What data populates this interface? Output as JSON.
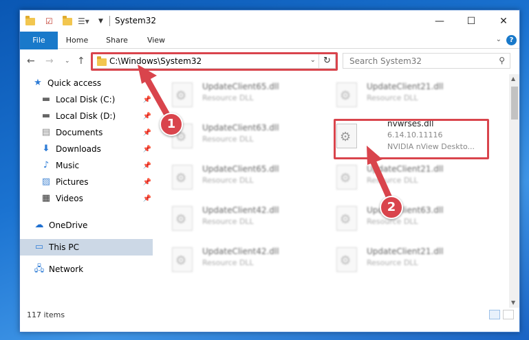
{
  "window": {
    "title": "System32"
  },
  "ribbon": {
    "tabs": [
      "File",
      "Home",
      "Share",
      "View"
    ],
    "help": "?"
  },
  "navbar": {
    "address": "C:\\Windows\\System32",
    "search_placeholder": "Search System32"
  },
  "sidebar": {
    "items": [
      {
        "label": "Quick access",
        "icon": "star-icon"
      },
      {
        "label": "Local Disk (C:)",
        "icon": "drive-icon"
      },
      {
        "label": "Local Disk (D:)",
        "icon": "drive-icon"
      },
      {
        "label": "Documents",
        "icon": "documents-icon"
      },
      {
        "label": "Downloads",
        "icon": "download-icon"
      },
      {
        "label": "Music",
        "icon": "music-icon"
      },
      {
        "label": "Pictures",
        "icon": "pictures-icon"
      },
      {
        "label": "Videos",
        "icon": "videos-icon"
      },
      {
        "label": "OneDrive",
        "icon": "cloud-icon"
      },
      {
        "label": "This PC",
        "icon": "computer-icon"
      },
      {
        "label": "Network",
        "icon": "network-icon"
      }
    ]
  },
  "files": {
    "left": [
      {
        "name": "UpdateClient65.dll",
        "desc": "Resource DLL"
      },
      {
        "name": "UpdateClient63.dll",
        "desc": "Resource DLL"
      },
      {
        "name": "UpdateClient65.dll",
        "desc": "Resource DLL"
      },
      {
        "name": "UpdateClient42.dll",
        "desc": "Resource DLL"
      },
      {
        "name": "UpdateClient42.dll",
        "desc": "Resource DLL"
      }
    ],
    "right": [
      {
        "name": "UpdateClient21.dll",
        "desc": "Resource DLL"
      },
      {
        "name": "nvwrses.dll",
        "desc": "6.14.10.11116",
        "desc2": "NVIDIA nView Deskto..."
      },
      {
        "name": "UpdateClient21.dll",
        "desc": "Resource DLL"
      },
      {
        "name": "UpdateClient63.dll",
        "desc": "Resource DLL"
      },
      {
        "name": "UpdateClient21.dll",
        "desc": "Resource DLL"
      }
    ]
  },
  "status": {
    "items": "117 items"
  },
  "annotations": {
    "badge1": "1",
    "badge2": "2",
    "color": "#d9444c"
  }
}
